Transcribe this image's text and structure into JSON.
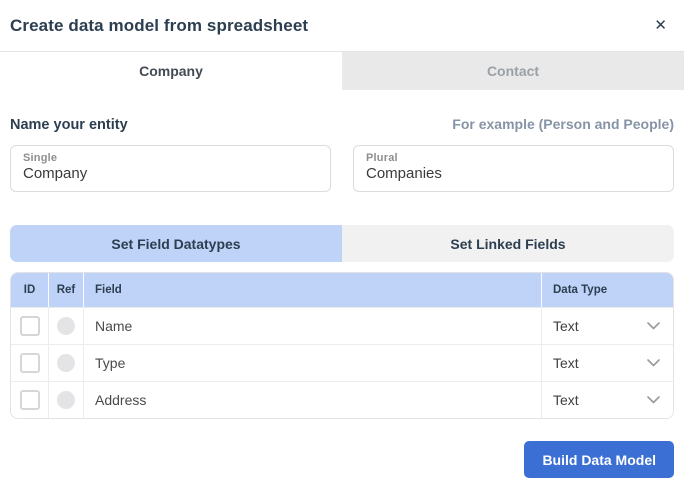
{
  "colors": {
    "accent_blue": "#3b6fd4",
    "tab_blue": "#bfd3f8",
    "inactive_tab_gray": "#e9e9e9",
    "inactive_subtab_gray": "#f1f1f1",
    "heading_navy": "#2d3e50"
  },
  "header": {
    "title": "Create data model from spreadsheet",
    "close_icon": "✕"
  },
  "entity_tabs": {
    "company": "Company",
    "contact": "Contact"
  },
  "naming": {
    "heading": "Name your entity",
    "hint": "For example (Person and People)",
    "single_label": "Single",
    "single_value": "Company",
    "plural_label": "Plural",
    "plural_value": "Companies"
  },
  "field_tabs": {
    "datatypes": "Set Field Datatypes",
    "linked": "Set Linked Fields"
  },
  "table": {
    "headers": {
      "id": "ID",
      "ref": "Ref",
      "field": "Field",
      "datatype": "Data Type"
    },
    "rows": [
      {
        "field": "Name",
        "datatype": "Text"
      },
      {
        "field": "Type",
        "datatype": "Text"
      },
      {
        "field": "Address",
        "datatype": "Text"
      }
    ]
  },
  "footer": {
    "build_button": "Build Data Model"
  }
}
